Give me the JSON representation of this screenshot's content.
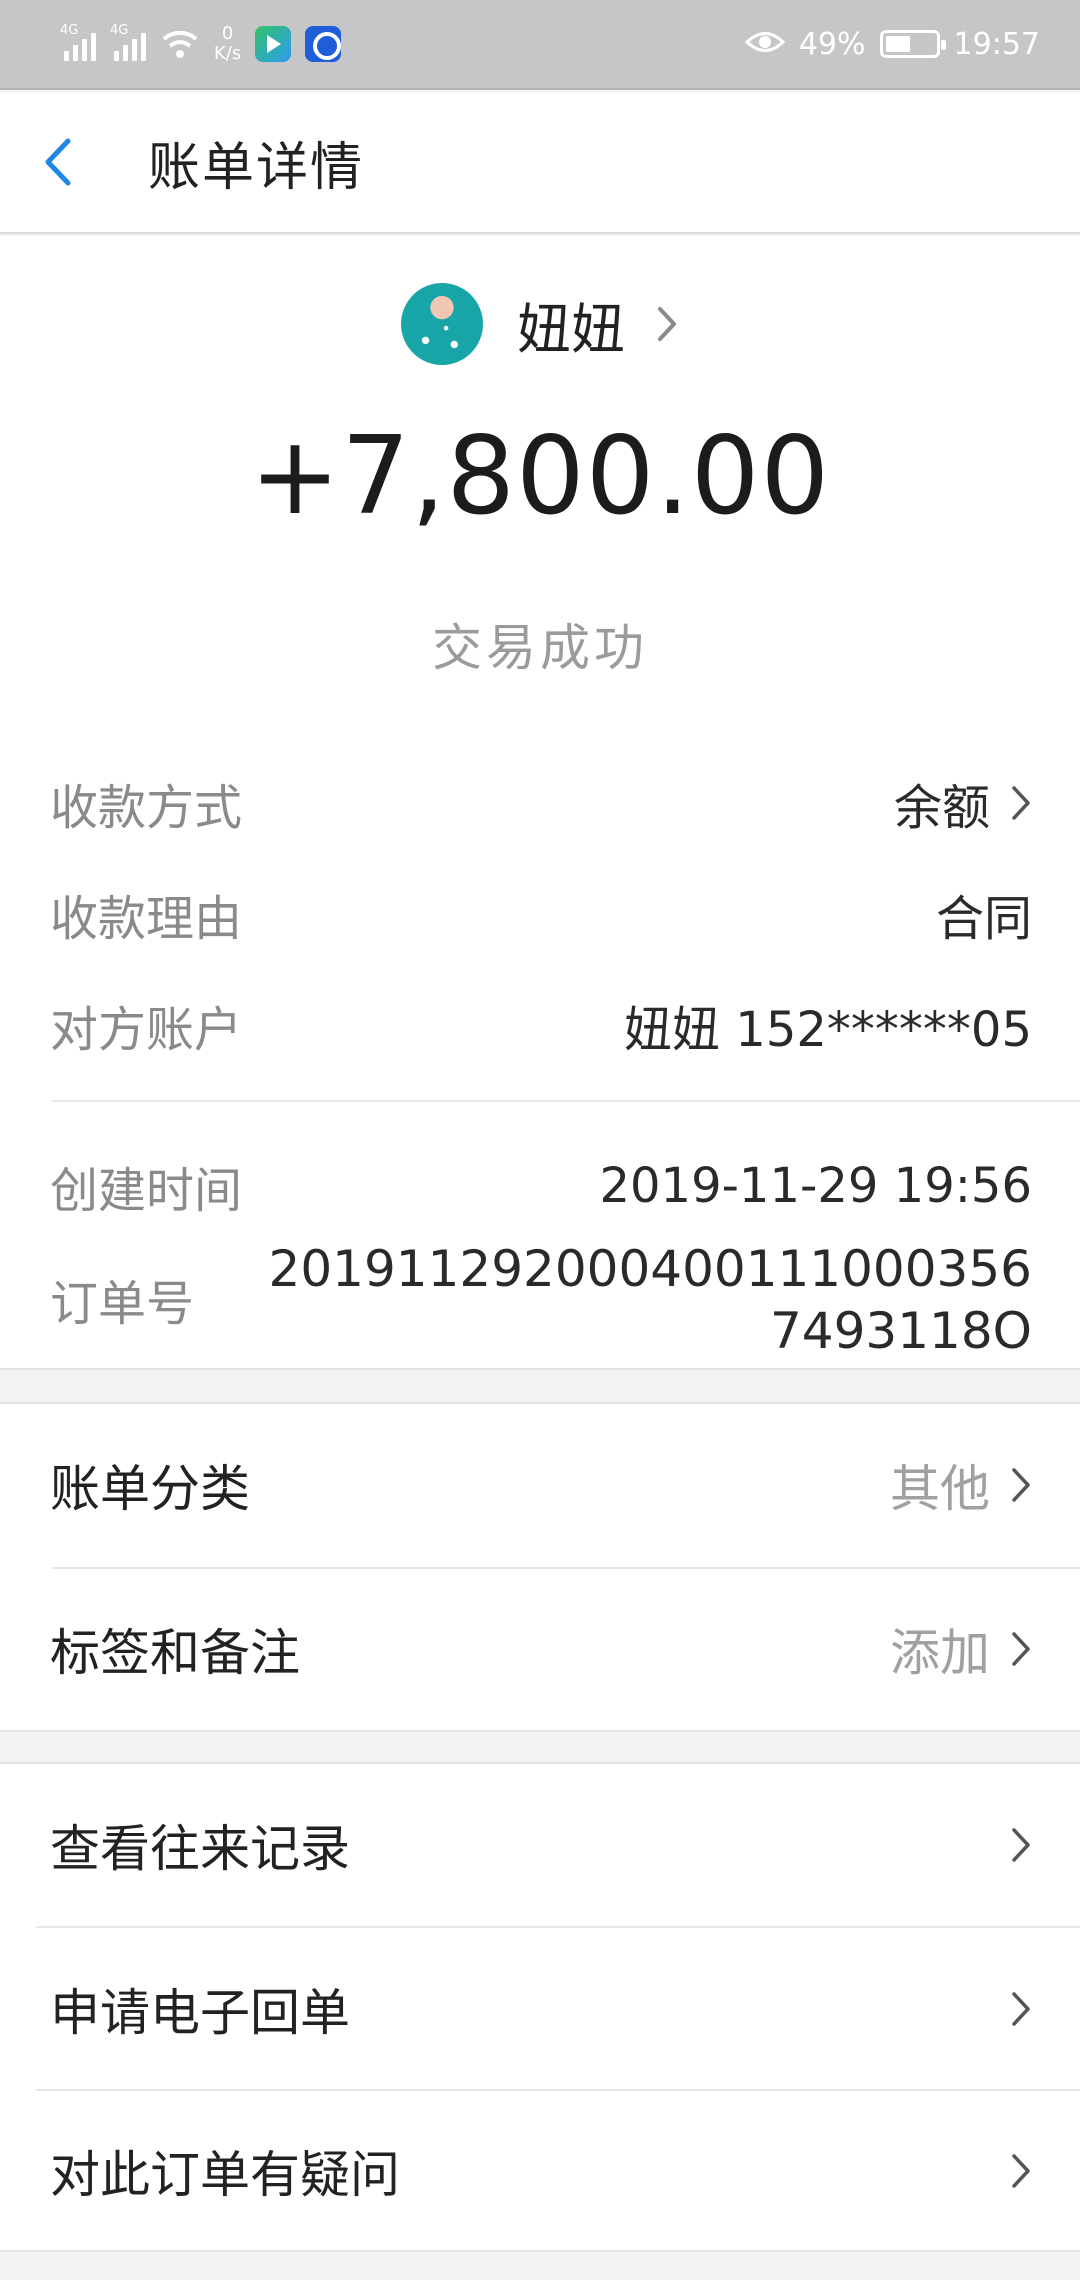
{
  "status_bar": {
    "net1": "4G",
    "net2": "4G",
    "speed_value": "0",
    "speed_unit": "K/s",
    "battery_percent": "49%",
    "battery_level": 0.49,
    "time": "19:57"
  },
  "header": {
    "title": "账单详情"
  },
  "bill": {
    "payee_name": "妞妞",
    "amount": "+7,800.00",
    "status": "交易成功",
    "details": [
      {
        "label": "收款方式",
        "value": "余额"
      },
      {
        "label": "收款理由",
        "value": "合同"
      },
      {
        "label": "对方账户",
        "value": "妞妞 152******05"
      }
    ],
    "created_label": "创建时间",
    "created_value": "2019-11-29 19:56",
    "order_label": "订单号",
    "order_value": "2019112920004001110003567493118O"
  },
  "classify": {
    "category_label": "账单分类",
    "category_value": "其他",
    "tags_label": "标签和备注",
    "tags_value": "添加"
  },
  "actions": [
    {
      "label": "查看往来记录"
    },
    {
      "label": "申请电子回单"
    },
    {
      "label": "对此订单有疑问"
    }
  ],
  "colors": {
    "accent": "#1e88e5",
    "status_bar_bg": "#c6c6c8",
    "page_bg": "#f3f3f5"
  }
}
